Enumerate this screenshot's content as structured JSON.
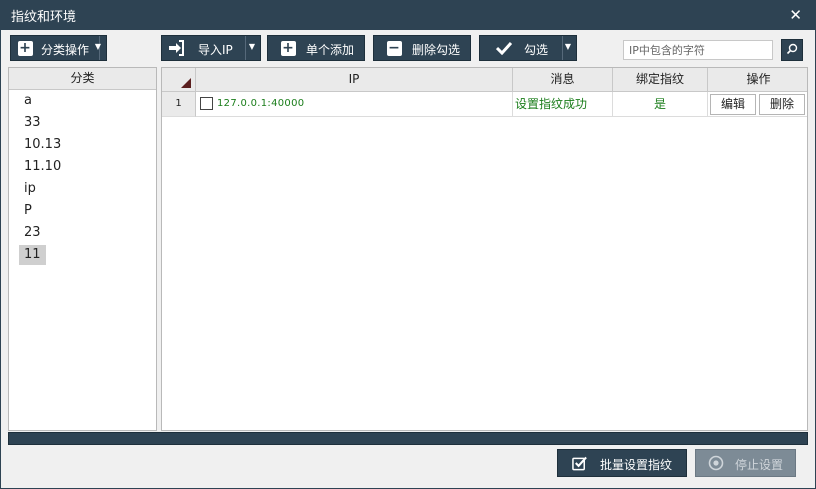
{
  "window": {
    "title": "指纹和环境",
    "close_glyph": "✕"
  },
  "toolbar": {
    "category_ops_label": "分类操作",
    "import_ip_label": "导入IP",
    "add_single_label": "单个添加",
    "delete_checked_label": "删除勾选",
    "check_label": "勾选"
  },
  "search": {
    "placeholder": "IP中包含的字符",
    "value": ""
  },
  "categories": {
    "header": "分类",
    "items": [
      "a",
      "33",
      "10.13",
      "11.10",
      "ip",
      "P",
      "23",
      "11"
    ],
    "selected": "11"
  },
  "table": {
    "columns": {
      "ip": "IP",
      "message": "消息",
      "bound": "绑定指纹",
      "actions": "操作"
    },
    "rows": [
      {
        "index": "1",
        "ip": "127.0.0.1:40000",
        "message": "设置指纹成功",
        "bound": "是",
        "edit": "编辑",
        "delete": "删除",
        "checked": false
      }
    ]
  },
  "progress": {
    "value": 0
  },
  "footer": {
    "batch_label": "批量设置指纹",
    "stop_label": "停止设置"
  },
  "colors": {
    "primary": "#2e4353",
    "success": "#1a7d1a",
    "selected_bg": "#cfcfcf"
  }
}
